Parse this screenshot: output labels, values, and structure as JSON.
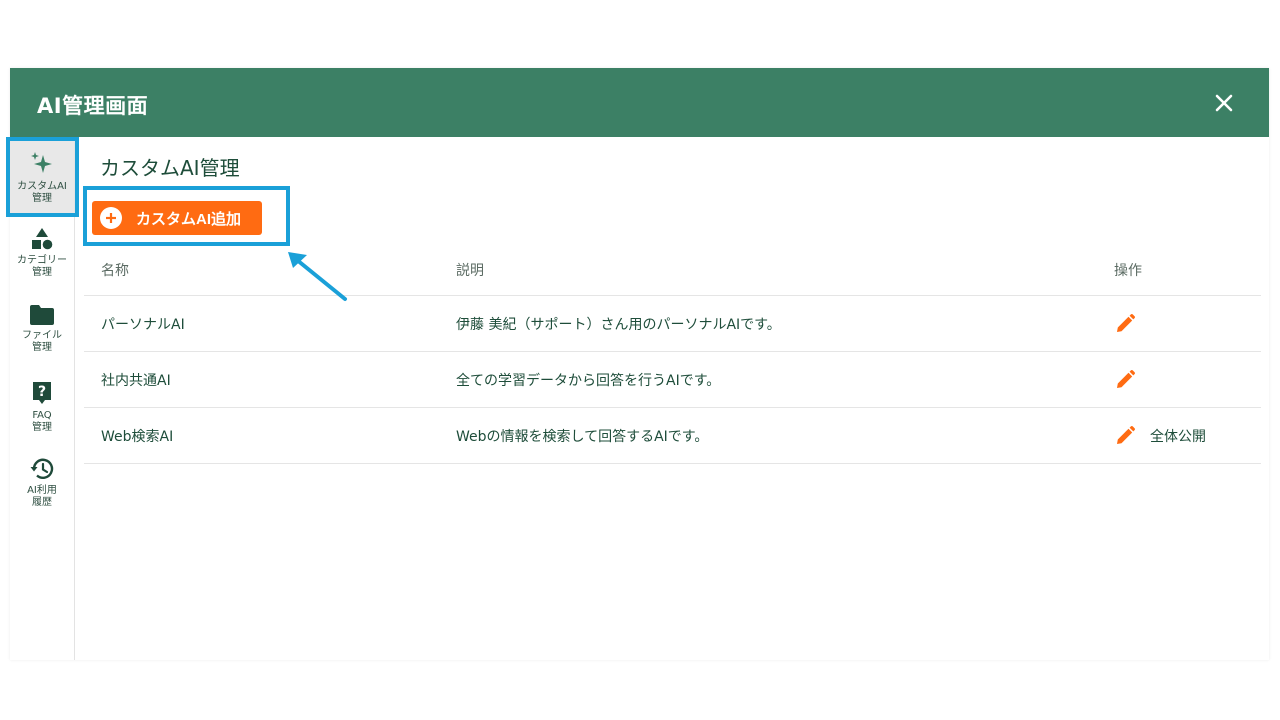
{
  "window": {
    "title": "AI管理画面"
  },
  "sidebar": {
    "items": [
      {
        "label_line1": "カスタムAI",
        "label_line2": "管理",
        "icon": "sparkle-icon"
      },
      {
        "label_line1": "カテゴリー",
        "label_line2": "管理",
        "icon": "shapes-icon"
      },
      {
        "label_line1": "ファイル",
        "label_line2": "管理",
        "icon": "folder-icon"
      },
      {
        "label_line1": "FAQ",
        "label_line2": "管理",
        "icon": "question-icon"
      },
      {
        "label_line1": "AI利用",
        "label_line2": "履歴",
        "icon": "history-icon"
      }
    ]
  },
  "main": {
    "title": "カスタムAI管理",
    "add_button_label": "カスタムAI追加",
    "table": {
      "headers": {
        "name": "名称",
        "description": "説明",
        "actions": "操作"
      },
      "rows": [
        {
          "name": "パーソナルAI",
          "description": "伊藤 美紀（サポート）さん用のパーソナルAIです。",
          "public_label": ""
        },
        {
          "name": "社内共通AI",
          "description": "全ての学習データから回答を行うAIです。",
          "public_label": ""
        },
        {
          "name": "Web検索AI",
          "description": "Webの情報を検索して回答するAIです。",
          "public_label": "全体公開"
        }
      ]
    }
  },
  "colors": {
    "header_bg": "#3c8065",
    "accent_orange": "#ff6b12",
    "highlight_blue": "#1aa0d8",
    "text_green": "#1e4d3a"
  }
}
